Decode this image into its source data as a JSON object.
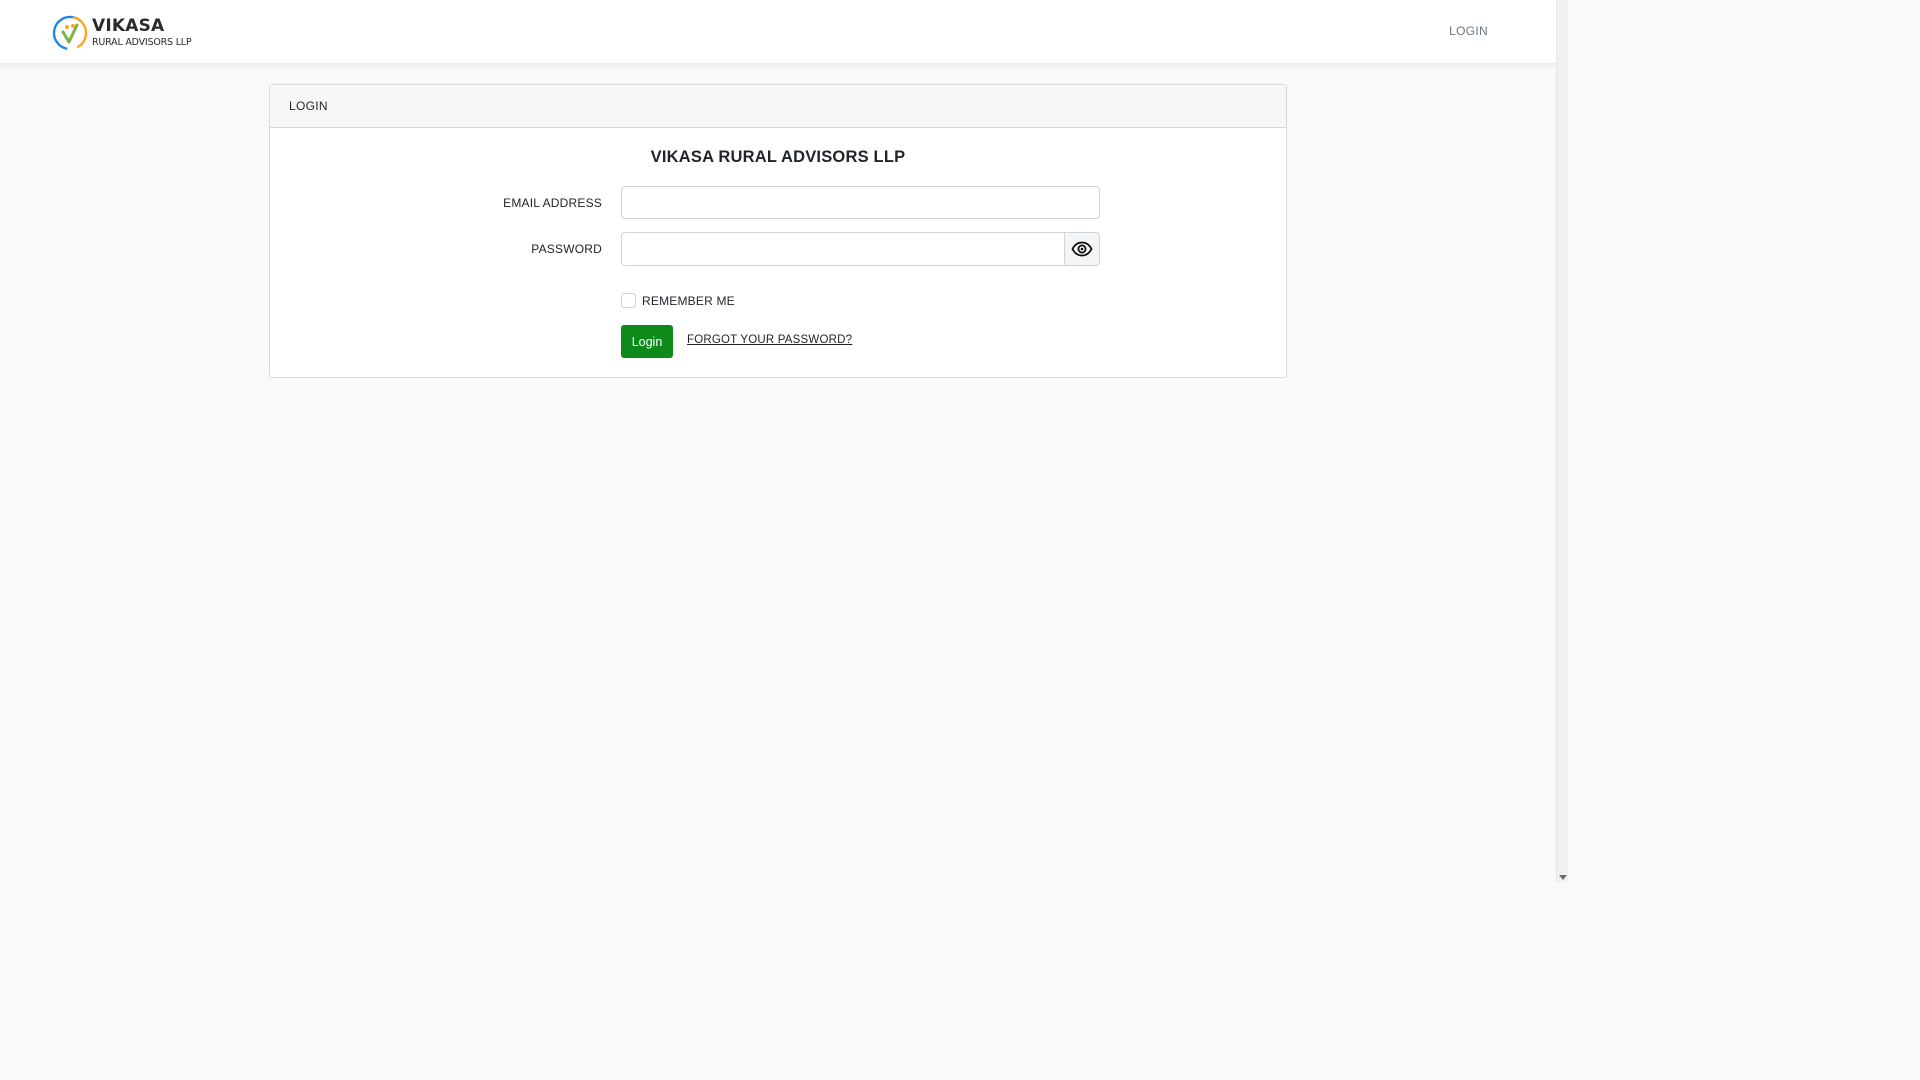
{
  "navbar": {
    "brand_name": "VIKASA",
    "brand_subtitle": "RURAL ADVISORS LLP",
    "login_link": "LOGIN"
  },
  "card": {
    "header": "LOGIN",
    "title": "VIKASA RURAL ADVISORS LLP",
    "email_label": "EMAIL ADDRESS",
    "email_value": "",
    "password_label": "PASSWORD",
    "password_value": "",
    "remember_label": "REMEMBER ME",
    "remember_checked": false,
    "login_button": "Login",
    "forgot_link": "FORGOT YOUR PASSWORD?"
  },
  "icons": {
    "logo": "vikasa-logo-icon",
    "toggle_password": "eye-icon"
  },
  "colors": {
    "primary_button": "#0e8a1a",
    "logo_green": "#7cb342",
    "logo_blue": "#1e88e5",
    "logo_orange": "#f9a825"
  }
}
